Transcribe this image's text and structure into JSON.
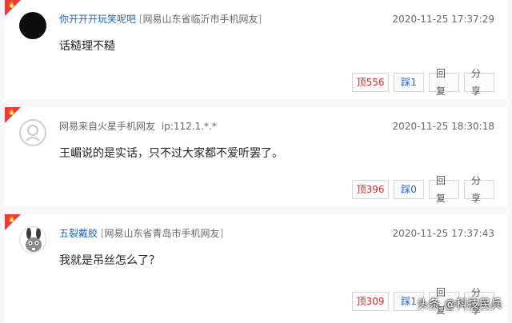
{
  "flame_glyph": "🔥",
  "comments": [
    {
      "username": "你开开开玩笑呢吧",
      "location": "网易山东省临沂市手机网友",
      "timestamp": "2020-11-25 17:37:29",
      "content": "话糙理不糙",
      "up_label": "顶",
      "up_count": "556",
      "down_label": "踩",
      "down_count": "1",
      "reply_label": "回复",
      "share_label": "分享"
    },
    {
      "username": "网易来自火星手机网友",
      "ip": "ip:112.1.*.*",
      "timestamp": "2020-11-25 18:30:18",
      "content": "王嵋说的是实话，只不过大家都不爱听罢了。",
      "up_label": "顶",
      "up_count": "396",
      "down_label": "踩",
      "down_count": "0",
      "reply_label": "回复",
      "share_label": "分享"
    },
    {
      "username": "五裂戴胶",
      "location": "网易山东省青岛市手机网友",
      "timestamp": "2020-11-25 17:37:43",
      "content": "我就是吊丝怎么了？",
      "up_label": "顶",
      "up_count": "309",
      "down_label": "踩",
      "down_count": "1",
      "reply_label": "回复",
      "share_label": "分享"
    }
  ],
  "watermark": "头条 @科技民兵",
  "colors": {
    "username_link": "#1f64b4",
    "hot_badge": "#e33d3d",
    "up_text": "#c62f2f",
    "down_text": "#2d63c8"
  }
}
